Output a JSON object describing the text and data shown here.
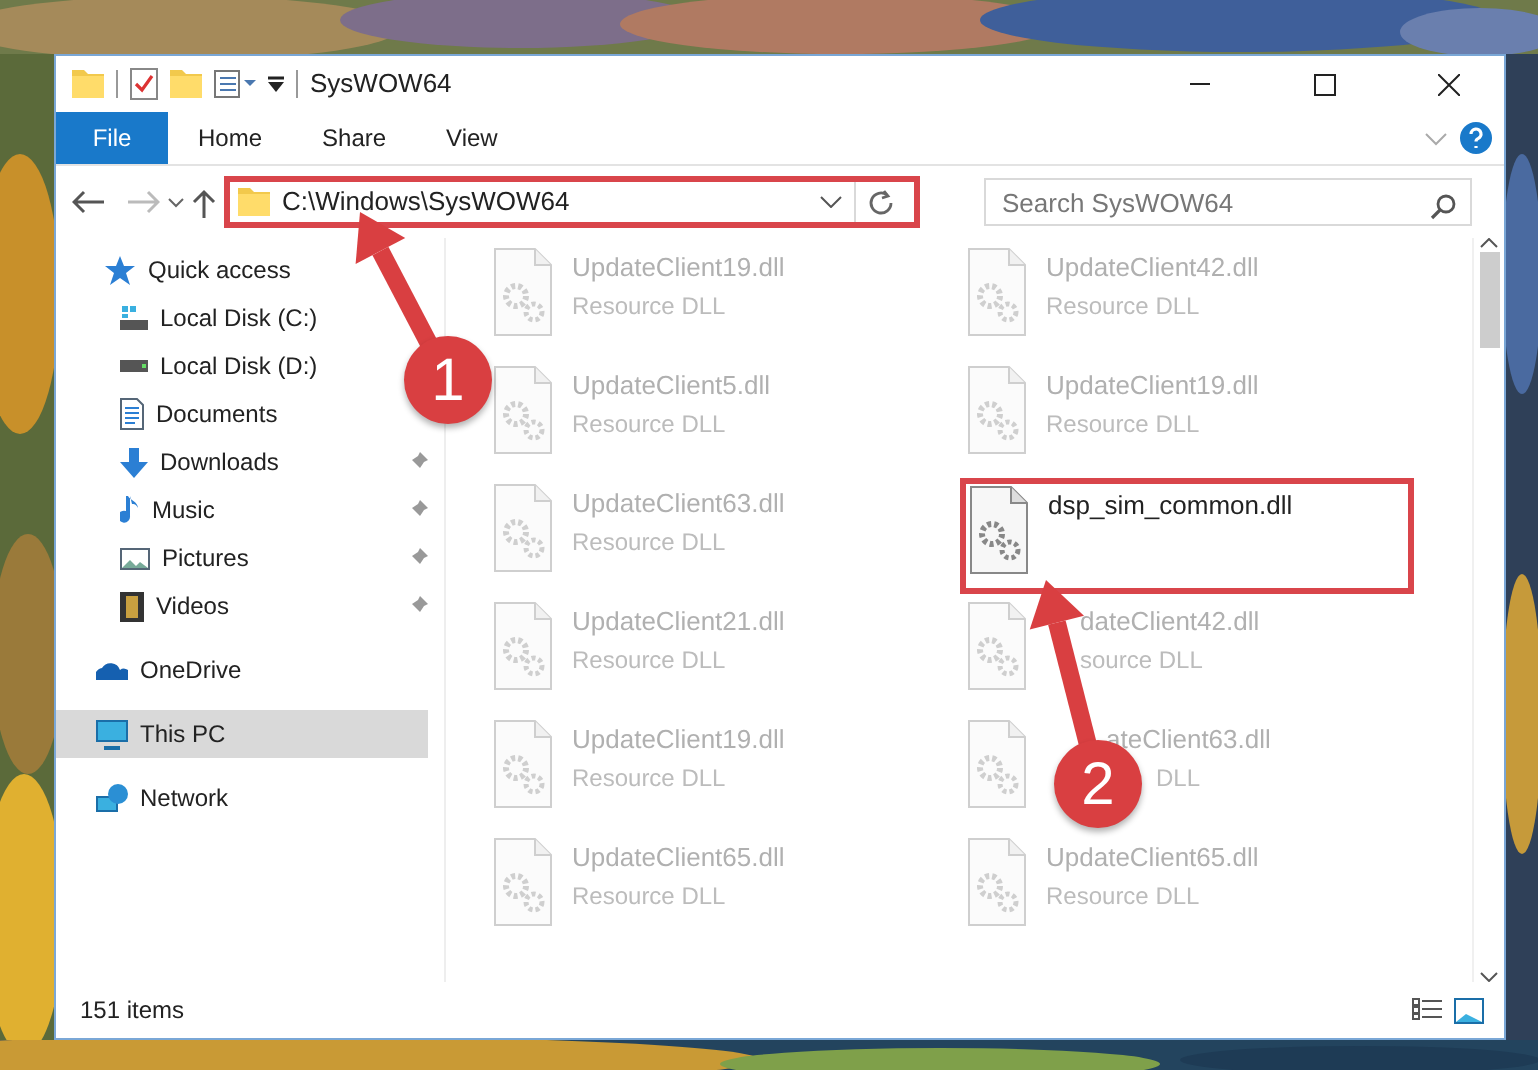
{
  "window": {
    "title": "SysWOW64"
  },
  "ribbon_tabs": [
    {
      "label": "File",
      "kind": "file"
    },
    {
      "label": "Home",
      "kind": "tab"
    },
    {
      "label": "Share",
      "kind": "tab"
    },
    {
      "label": "View",
      "kind": "tab"
    }
  ],
  "address": {
    "path": "C:\\Windows\\SysWOW64",
    "highlighted": true
  },
  "search": {
    "placeholder": "Search SysWOW64"
  },
  "sidebar": {
    "items": [
      {
        "label": "Quick access",
        "selected": false,
        "children": [
          {
            "label": "Local Disk (C:)",
            "pinned": false
          },
          {
            "label": "Local Disk (D:)",
            "pinned": false
          },
          {
            "label": "Documents",
            "pinned": false
          },
          {
            "label": "Downloads",
            "pinned": true
          },
          {
            "label": "Music",
            "pinned": true
          },
          {
            "label": "Pictures",
            "pinned": true
          },
          {
            "label": "Videos",
            "pinned": true
          }
        ]
      },
      {
        "label": "OneDrive",
        "selected": false
      },
      {
        "label": "This PC",
        "selected": true
      },
      {
        "label": "Network",
        "selected": false
      }
    ]
  },
  "files": [
    {
      "name": "UpdateClient19.dll",
      "type": "Resource DLL",
      "faded": true,
      "highlighted": false
    },
    {
      "name": "UpdateClient42.dll",
      "type": "Resource DLL",
      "faded": true,
      "highlighted": false
    },
    {
      "name": "UpdateClient5.dll",
      "type": "Resource DLL",
      "faded": true,
      "highlighted": false
    },
    {
      "name": "UpdateClient19.dll",
      "type": "Resource DLL",
      "faded": true,
      "highlighted": false
    },
    {
      "name": "UpdateClient63.dll",
      "type": "Resource DLL",
      "faded": true,
      "highlighted": false
    },
    {
      "name": "dsp_sim_common.dll",
      "faded": false,
      "highlighted": true
    },
    {
      "name": "UpdateClient21.dll",
      "type": "Resource DLL",
      "faded": true,
      "highlighted": false
    },
    {
      "name": "dateClient42.dll",
      "type": "source DLL",
      "faded": true,
      "highlighted": false
    },
    {
      "name": "UpdateClient19.dll",
      "type": "Resource DLL",
      "faded": true,
      "highlighted": false
    },
    {
      "name": "ateClient63.dll",
      "type": "DLL",
      "faded": true,
      "highlighted": false
    },
    {
      "name": "UpdateClient65.dll",
      "type": "Resource DLL",
      "faded": true,
      "highlighted": false
    },
    {
      "name": "UpdateClient65.dll",
      "type": "Resource DLL",
      "faded": true,
      "highlighted": false
    }
  ],
  "annotations": [
    {
      "number": "1"
    },
    {
      "number": "2"
    }
  ],
  "status_bar": {
    "count": "151 items"
  }
}
